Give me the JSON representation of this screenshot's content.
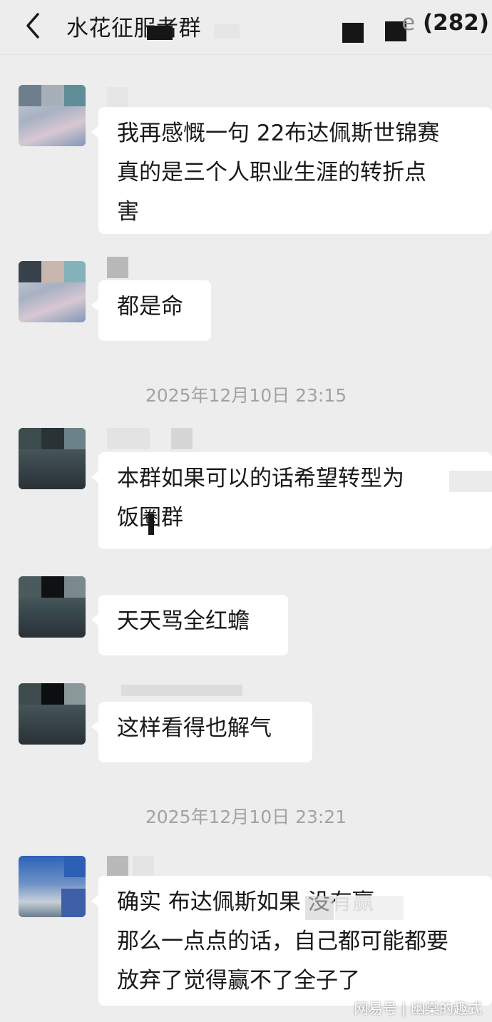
{
  "header": {
    "back_icon": "chevron-left-icon",
    "title": "水花征服者群",
    "title_suffix": "e",
    "member_count": "(282)"
  },
  "messages": [
    {
      "text": "我再感慨一句 22布达佩斯世锦赛\n真的是三个人职业生涯的转折点\n害"
    },
    {
      "text": "都是命"
    },
    {
      "text": "本群如果可以的话希望转型为\n饭圈群"
    },
    {
      "text": "天天骂全红蟾"
    },
    {
      "text": "这样看得也解气"
    },
    {
      "text": "确实 布达佩斯如果 没有赢\n那么一点点的话，自己都可能都要\n放弃了觉得赢不了全子了"
    }
  ],
  "timestamps": [
    "2025年12月10日 23:15",
    "2025年12月10日 23:21"
  ],
  "watermark": "网易号 | 幽棠的趣式",
  "colors": {
    "background": "#ededed",
    "bubble": "#ffffff",
    "timestamp": "#a2a2a2"
  }
}
